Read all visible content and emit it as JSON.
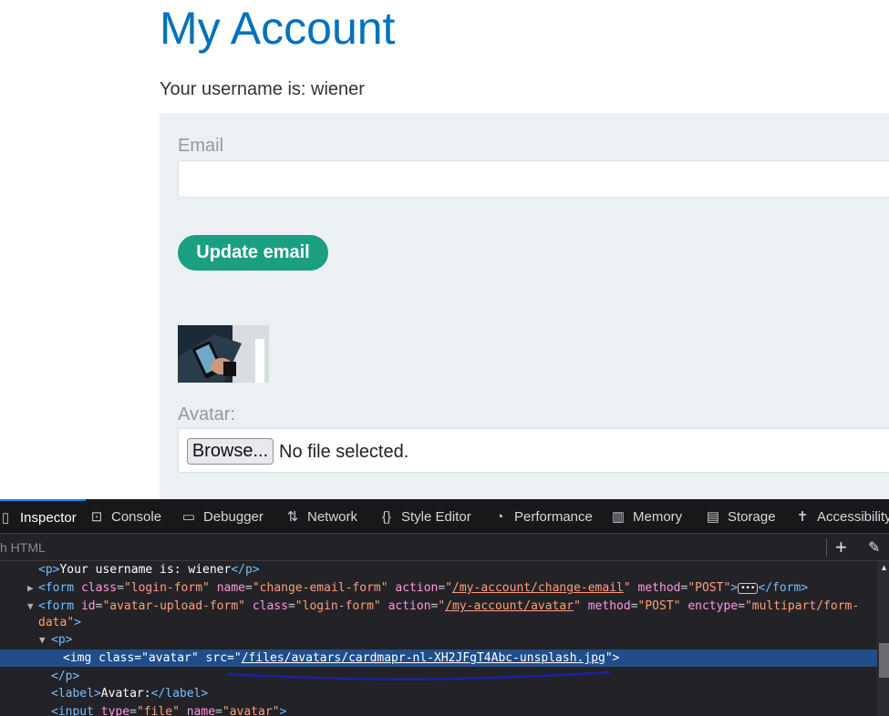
{
  "page": {
    "title": "My Account",
    "username_text": "Your username is: wiener",
    "email_label": "Email",
    "email_value": "",
    "update_email_label": "Update email",
    "avatar_label": "Avatar:",
    "browse_label": "Browse...",
    "no_file_text": "No file selected."
  },
  "devtools": {
    "tabs": [
      {
        "label": "Inspector",
        "icon": "inspector-icon"
      },
      {
        "label": "Console",
        "icon": "console-icon"
      },
      {
        "label": "Debugger",
        "icon": "debugger-icon"
      },
      {
        "label": "Network",
        "icon": "network-icon"
      },
      {
        "label": "Style Editor",
        "icon": "style-editor-icon"
      },
      {
        "label": "Performance",
        "icon": "performance-icon"
      },
      {
        "label": "Memory",
        "icon": "memory-icon"
      },
      {
        "label": "Storage",
        "icon": "storage-icon"
      },
      {
        "label": "Accessibility",
        "icon": "accessibility-icon"
      }
    ],
    "search_placeholder": "h HTML",
    "accent_color": "#0a84ff",
    "tree": {
      "r1": {
        "text": "Your username is: wiener"
      },
      "r2": {
        "class": "login-form",
        "name": "change-email-form",
        "action": "/my-account/change-email",
        "method": "POST"
      },
      "r3": {
        "id": "avatar-upload-form",
        "class": "login-form",
        "action": "/my-account/avatar",
        "method": "POST",
        "enctype_part1": "multipart/form-",
        "enctype_part2": "data"
      },
      "r5": {
        "class": "avatar",
        "src": "/files/avatars/cardmapr-nl-XH2JFgT4Abc-unsplash.jpg"
      },
      "r7": {
        "text": "Avatar:"
      },
      "r8": {
        "type": "file",
        "name": "avatar"
      }
    }
  },
  "colors": {
    "title": "#0071bc",
    "button": "#1a9f81",
    "panel": "#ebf0f2",
    "selection": "#204e8a",
    "annotation": "#1f1fa8"
  }
}
